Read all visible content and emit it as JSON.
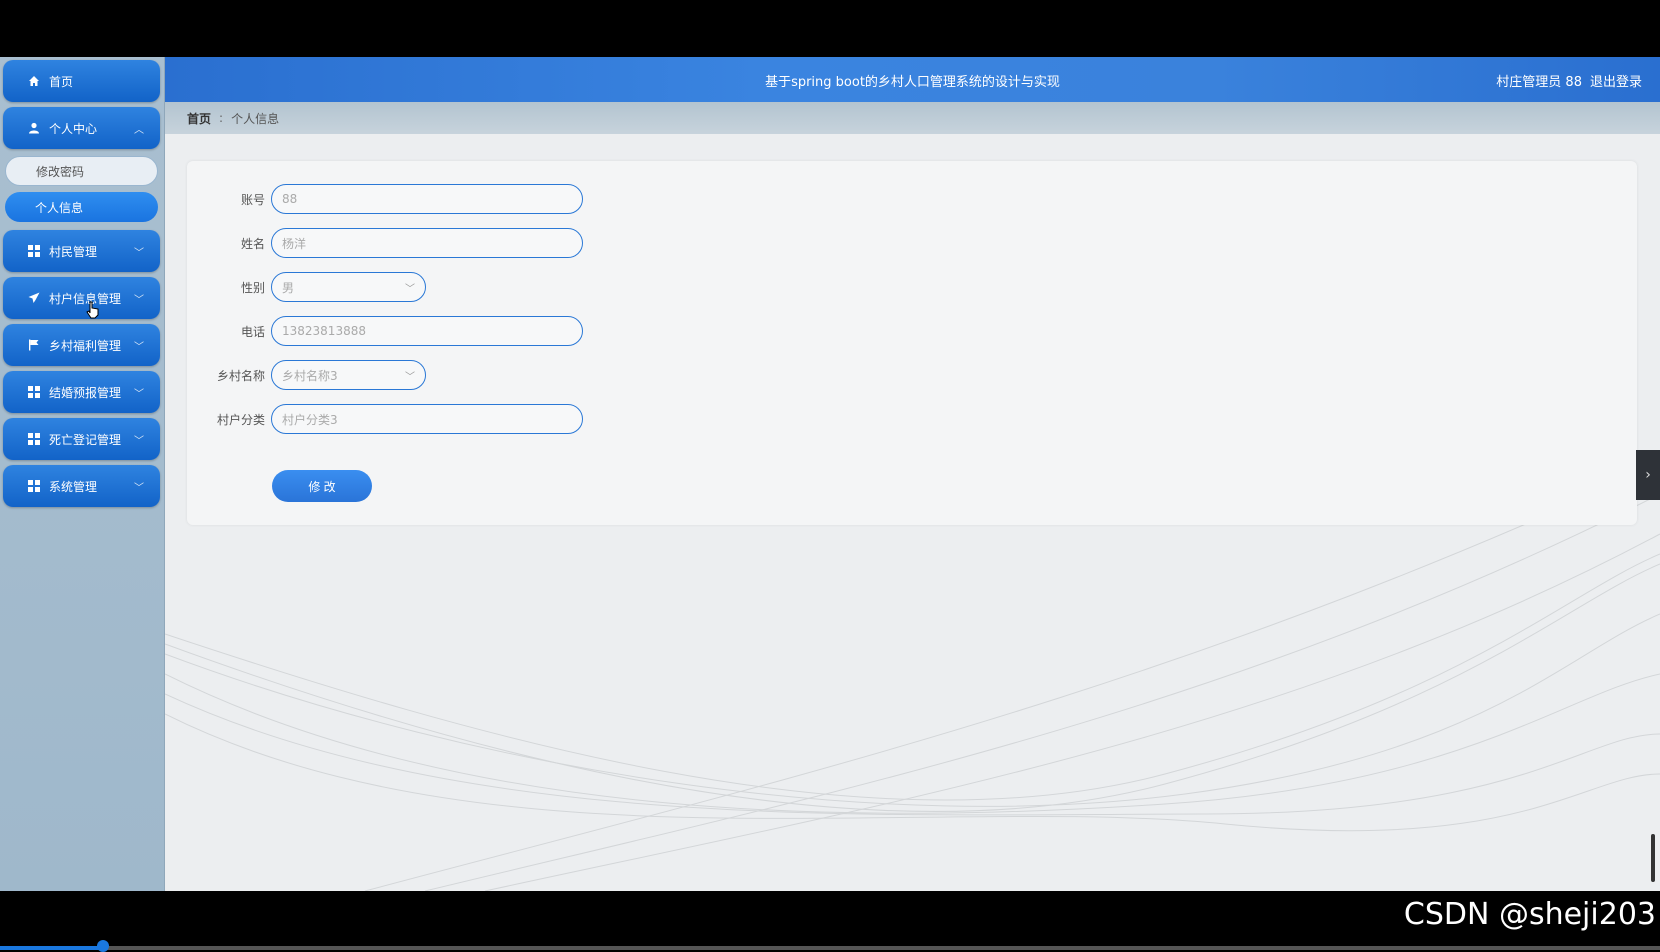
{
  "header": {
    "title": "基于spring boot的乡村人口管理系统的设计与实现",
    "user_label": "村庄管理员 88",
    "logout_label": "退出登录"
  },
  "breadcrumb": {
    "home": "首页",
    "separator": ":",
    "current": "个人信息"
  },
  "sidebar": {
    "items": [
      {
        "label": "首页",
        "icon": "home-icon"
      },
      {
        "label": "个人中心",
        "icon": "user-icon",
        "expanded": true
      },
      {
        "label": "村民管理",
        "icon": "grid-icon"
      },
      {
        "label": "村户信息管理",
        "icon": "send-icon"
      },
      {
        "label": "乡村福利管理",
        "icon": "flag-icon"
      },
      {
        "label": "结婚预报管理",
        "icon": "grid-icon"
      },
      {
        "label": "死亡登记管理",
        "icon": "grid-icon"
      },
      {
        "label": "系统管理",
        "icon": "grid-icon"
      }
    ],
    "sub_items": [
      {
        "label": "修改密码"
      },
      {
        "label": "个人信息",
        "active": true
      }
    ]
  },
  "form": {
    "account_label": "账号",
    "account_value": "88",
    "name_label": "姓名",
    "name_value": "杨洋",
    "gender_label": "性别",
    "gender_value": "男",
    "phone_label": "电话",
    "phone_value": "13823813888",
    "village_label": "乡村名称",
    "village_value": "乡村名称3",
    "category_label": "村户分类",
    "category_value": "村户分类3",
    "submit_label": "修 改"
  },
  "watermark": "CSDN @sheji203",
  "video_progress": 0.062,
  "colors": {
    "accent": "#2a74d8",
    "header": "#3a84e0",
    "sidebar_bg": "#a9bfd0"
  }
}
